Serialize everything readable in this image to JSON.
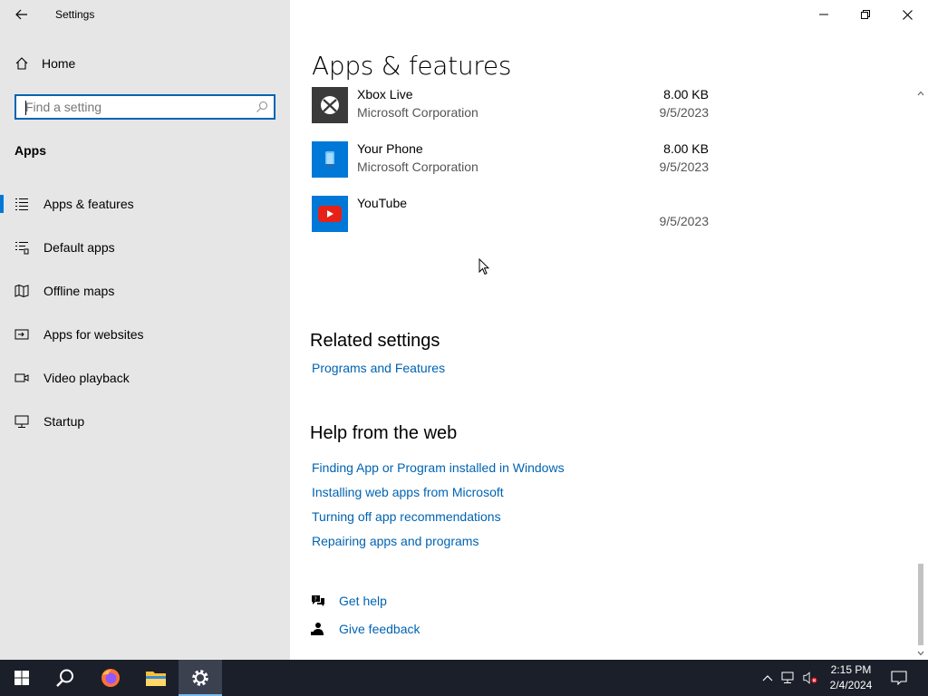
{
  "window": {
    "title": "Settings"
  },
  "sidebar": {
    "home_label": "Home",
    "search_placeholder": "Find a setting",
    "section_heading": "Apps",
    "items": [
      {
        "label": "Apps & features",
        "icon": "list-icon",
        "active": true
      },
      {
        "label": "Default apps",
        "icon": "default-apps-icon",
        "active": false
      },
      {
        "label": "Offline maps",
        "icon": "map-icon",
        "active": false
      },
      {
        "label": "Apps for websites",
        "icon": "website-link-icon",
        "active": false
      },
      {
        "label": "Video playback",
        "icon": "video-icon",
        "active": false
      },
      {
        "label": "Startup",
        "icon": "startup-icon",
        "active": false
      }
    ]
  },
  "main": {
    "title": "Apps & features",
    "apps": [
      {
        "name": "Xbox Live",
        "publisher": "Microsoft Corporation",
        "size": "8.00 KB",
        "date": "9/5/2023",
        "icon": "xbox-icon",
        "color": "#3a3a3a"
      },
      {
        "name": "Your Phone",
        "publisher": "Microsoft Corporation",
        "size": "8.00 KB",
        "date": "9/5/2023",
        "icon": "phone-icon",
        "color": "#0078d7"
      },
      {
        "name": "YouTube",
        "publisher": "",
        "size": "",
        "date": "9/5/2023",
        "icon": "youtube-icon",
        "color": "#0078d7"
      }
    ],
    "related": {
      "heading": "Related settings",
      "links": [
        "Programs and Features"
      ]
    },
    "help": {
      "heading": "Help from the web",
      "links": [
        "Finding App or Program installed in Windows",
        "Installing web apps from Microsoft",
        "Turning off app recommendations",
        "Repairing apps and programs"
      ]
    },
    "get_help": "Get help",
    "give_feedback": "Give feedback"
  },
  "taskbar": {
    "time": "2:15 PM",
    "date": "2/4/2024"
  },
  "colors": {
    "accent": "#0078d7",
    "link": "#0063b1",
    "sidebar_bg": "#e6e6e6",
    "taskbar_bg": "#1b1f2a"
  }
}
